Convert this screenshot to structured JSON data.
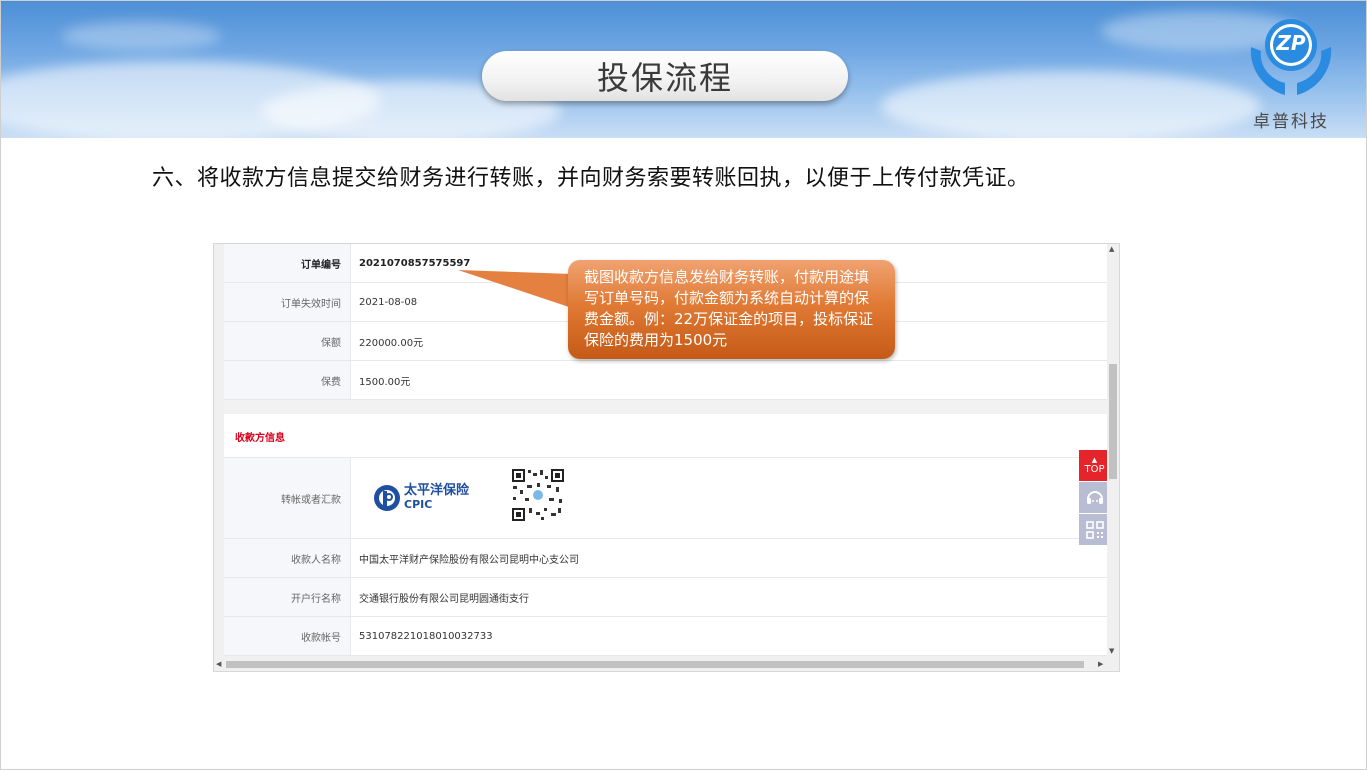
{
  "header": {
    "title": "投保流程",
    "logo_mark": "ZP",
    "logo_text": "卓普科技"
  },
  "subtitle": "六、将收款方信息提交给财务进行转账，并向财务索要转账回执，以便于上传付款凭证。",
  "order_info": {
    "rows": [
      {
        "label": "订单编号",
        "value": "2021070857575597"
      },
      {
        "label": "订单失效时间",
        "value": "2021-08-08"
      },
      {
        "label": "保额",
        "value": "220000.00元"
      },
      {
        "label": "保费",
        "value": "1500.00元"
      }
    ]
  },
  "payee": {
    "section_title": "收款方信息",
    "transfer_label": "转帐或者汇款",
    "bank_logo_cn": "太平洋保险",
    "bank_logo_en": "CPIC",
    "rows": [
      {
        "label": "收款人名称",
        "value": "中国太平洋财产保险股份有限公司昆明中心支公司"
      },
      {
        "label": "开户行名称",
        "value": "交通银行股份有限公司昆明圆通街支行"
      },
      {
        "label": "收款帐号",
        "value": "531078221018010032733"
      }
    ]
  },
  "float_buttons": {
    "top_label": "TOP"
  },
  "callout": {
    "text": "截图收款方信息发给财务转账，付款用途填写订单号码，付款金额为系统自动计算的保费金额。例：22万保证金的项目，投标保证保险的费用为1500元"
  },
  "colors": {
    "accent_red": "#d9001b",
    "callout_orange": "#e07a35",
    "logo_blue": "#2b8be0"
  }
}
